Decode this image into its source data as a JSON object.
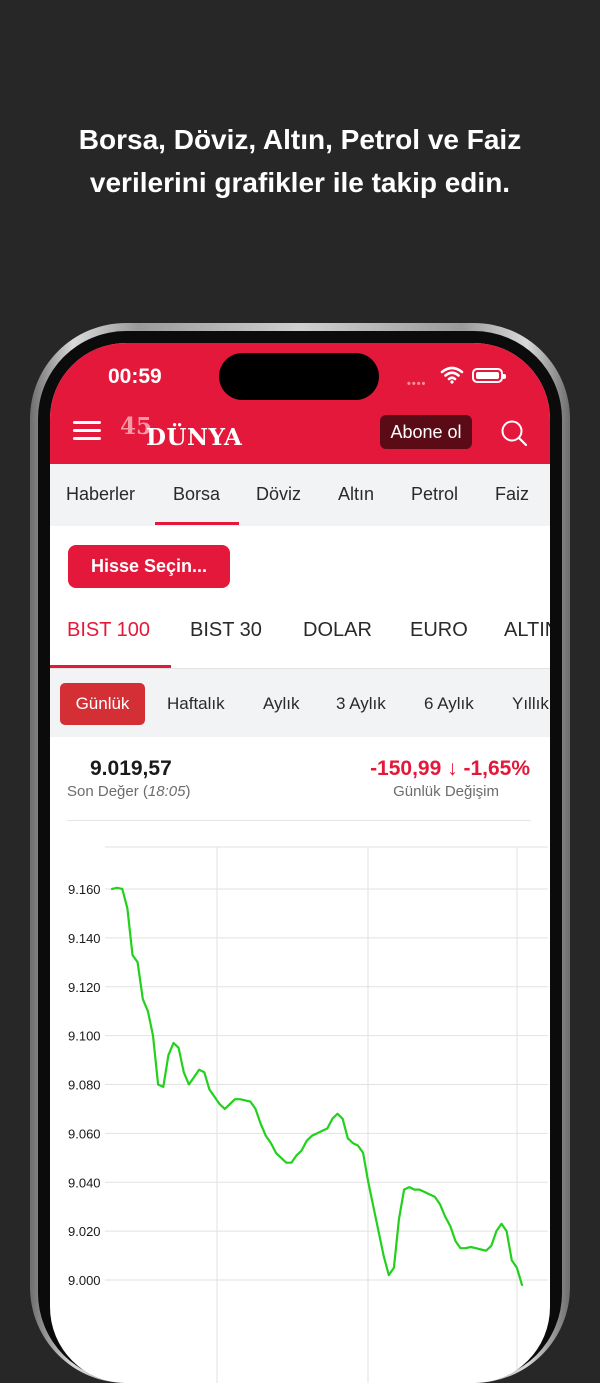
{
  "headline": {
    "line1": "Borsa, Döviz, Altın, Petrol ve Faiz",
    "line2": "verilerini grafikler ile takip edin."
  },
  "status_bar": {
    "time": "00:59"
  },
  "header": {
    "logo_number": "45",
    "logo_name": "DÜNYA",
    "subscribe_label": "Abone ol"
  },
  "nav": {
    "items": [
      {
        "label": "Haberler"
      },
      {
        "label": "Borsa"
      },
      {
        "label": "Döviz"
      },
      {
        "label": "Altın"
      },
      {
        "label": "Petrol"
      },
      {
        "label": "Faiz"
      }
    ],
    "active": "Borsa"
  },
  "stock_select_label": "Hisse Seçin...",
  "index_tabs": {
    "items": [
      {
        "label": "BIST 100"
      },
      {
        "label": "BIST 30"
      },
      {
        "label": "DOLAR"
      },
      {
        "label": "EURO"
      },
      {
        "label": "ALTIN"
      }
    ],
    "active": "BIST 100"
  },
  "period_tabs": {
    "items": [
      {
        "label": "Günlük"
      },
      {
        "label": "Haftalık"
      },
      {
        "label": "Aylık"
      },
      {
        "label": "3 Aylık"
      },
      {
        "label": "6 Aylık"
      },
      {
        "label": "Yıllık"
      }
    ],
    "active": "Günlük"
  },
  "quote": {
    "last_value": "9.019,57",
    "last_value_label": "Son Değer",
    "time": "18:05",
    "change": "-150,99 ↓ -1,65%",
    "change_label": "Günlük Değişim"
  },
  "colors": {
    "brand_red": "#e4183a",
    "line_green": "#22d11c",
    "background": "#272727"
  },
  "chart_data": {
    "type": "line",
    "title": "",
    "xlabel": "",
    "ylabel": "",
    "ylim": [
      8995,
      9170
    ],
    "y_ticks": [
      "9.160",
      "9.140",
      "9.120",
      "9.100",
      "9.080",
      "9.060",
      "9.040",
      "9.020",
      "9.000"
    ],
    "y_tick_values": [
      9160,
      9140,
      9120,
      9100,
      9080,
      9060,
      9040,
      9020,
      9000
    ],
    "grid": true,
    "series": [
      {
        "values": [
          9160,
          9160.5,
          9160,
          9152,
          9133,
          9130,
          9115,
          9110,
          9100,
          9080,
          9079,
          9092,
          9097,
          9095,
          9085,
          9080,
          9083,
          9086,
          9085,
          9078,
          9075,
          9072,
          9070,
          9072,
          9074,
          9074,
          9073.5,
          9073,
          9070,
          9064,
          9059,
          9056,
          9052,
          9050,
          9048,
          9048,
          9051,
          9053,
          9057,
          9059,
          9060,
          9061,
          9062,
          9066,
          9068,
          9066,
          9058,
          9056,
          9055,
          9052,
          9040,
          9030,
          9020,
          9010,
          9002,
          9005,
          9025,
          9037,
          9038,
          9037,
          9037,
          9036,
          9035,
          9034,
          9031,
          9026,
          9022,
          9016,
          9013,
          9013,
          9013.5,
          9013,
          9012.5,
          9012,
          9014,
          9020,
          9023,
          9020,
          9008,
          9005,
          8998
        ]
      }
    ]
  }
}
